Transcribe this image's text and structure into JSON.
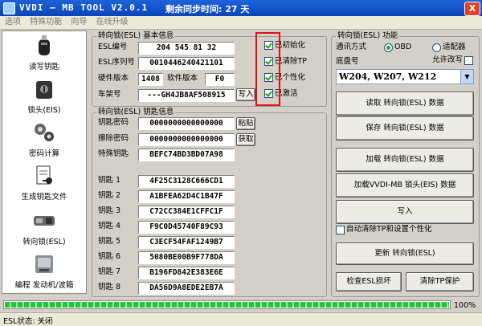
{
  "window": {
    "title": "VVDI — MB TOOL V2.0.1",
    "sync_text": "剩余同步时间: 27 天",
    "close_label": "X"
  },
  "menu": [
    "选项",
    "特殊功能",
    "向导",
    "在线升级"
  ],
  "sidebar": {
    "items": [
      {
        "label": "读写钥匙",
        "icon": "key-fob-icon"
      },
      {
        "label": "锁头(EIS)",
        "icon": "ignition-lock-icon"
      },
      {
        "label": "密码计算",
        "icon": "calculator-gears-icon"
      },
      {
        "label": "生成钥匙文件",
        "icon": "key-file-icon"
      },
      {
        "label": "转向锁(ESL)",
        "icon": "steering-lock-icon"
      },
      {
        "label": "编程 发动机/波箱",
        "icon": "engine-ecu-icon"
      }
    ]
  },
  "esl_info": {
    "title": "转向锁(ESL) 基本信息",
    "esl_id_label": "ESL编号",
    "esl_id": "204 545 81 32",
    "serial_label": "ESL序列号",
    "serial": "0010446240421101",
    "hw_label": "硬件版本",
    "hw": "1408",
    "sw_label": "软件版本",
    "sw": "F0",
    "vin_label": "车架号",
    "vin": "---GH4JB8AF508915",
    "write_label": "写入",
    "flags": [
      {
        "label": "已初始化",
        "checked": true
      },
      {
        "label": "已清除TP",
        "checked": true
      },
      {
        "label": "已个性化",
        "checked": true
      },
      {
        "label": "已激活",
        "checked": true
      }
    ]
  },
  "key_info": {
    "title": "转向锁(ESL) 钥匙信息",
    "key_password_label": "钥匙密码",
    "key_password": "0000000000000000",
    "paste_label": "粘贴",
    "erase_password_label": "擦除密码",
    "erase_password": "0000000000000000",
    "get_label": "获取",
    "special_key_label": "特殊钥匙",
    "special_key": "BEFC74BD3BD07A98",
    "keys": [
      {
        "label": "钥匙 1",
        "value": "4F25C3128C666CD1"
      },
      {
        "label": "钥匙 2",
        "value": "A1BFEA62D4C1B47F"
      },
      {
        "label": "钥匙 3",
        "value": "C72CC384E1CFFC1F"
      },
      {
        "label": "钥匙 4",
        "value": "F9C0D45740F89C93"
      },
      {
        "label": "钥匙 5",
        "value": "C3ECF54FAF1249B7"
      },
      {
        "label": "钥匙 6",
        "value": "5080BE00B9F778DA"
      },
      {
        "label": "钥匙 7",
        "value": "B196FD842E383E6E"
      },
      {
        "label": "钥匙 8",
        "value": "DA56D9A8EDE2EB7A"
      }
    ]
  },
  "esl_functions": {
    "title": "转向锁(ESL) 功能",
    "comm_label": "通讯方式",
    "obd_label": "OBD",
    "adapter_label": "适配器",
    "comm_selected": "OBD",
    "chassis_label": "底盘号",
    "allow_edit_label": "允许改写",
    "chassis_value": "W204, W207, W212",
    "buttons": [
      "读取 转向锁(ESL) 数据",
      "保存 转向锁(ESL) 数据",
      "加载 转向锁(ESL) 数据",
      "加载VVDI-MB 锁头(EIS) 数据",
      "写入"
    ],
    "auto_clear_label": "自动清除TP和设置个性化",
    "renew_label": "更新 转向锁(ESL)",
    "check_damage_label": "检查ESL损坏",
    "clear_tp_label": "清除TP保护"
  },
  "progress": {
    "value": 100,
    "label": "100%"
  },
  "status": {
    "text": "ESL状态: 关闭"
  },
  "colors": {
    "titlebar": "#0b45b8",
    "highlight": "#e01010",
    "progress": "#27c23b"
  }
}
